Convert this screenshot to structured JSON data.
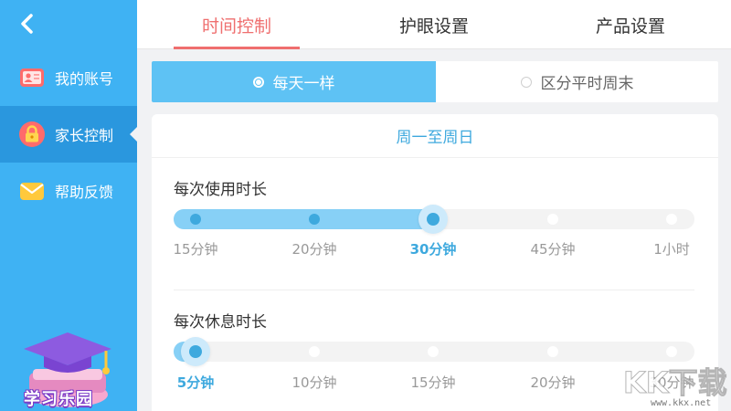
{
  "sidebar": {
    "items": [
      {
        "label": "我的账号",
        "icon": "id-card-icon"
      },
      {
        "label": "家长控制",
        "icon": "lock-icon",
        "active": true
      },
      {
        "label": "帮助反馈",
        "icon": "envelope-icon"
      }
    ],
    "mascot_text": "学习乐园"
  },
  "tabs": [
    {
      "label": "时间控制",
      "active": true
    },
    {
      "label": "护眼设置"
    },
    {
      "label": "产品设置"
    }
  ],
  "mode": {
    "options": [
      "每天一样",
      "区分平时周末"
    ],
    "selected": "每天一样"
  },
  "card": {
    "title": "周一至周日",
    "usage": {
      "label": "每次使用时长",
      "ticks": [
        "15分钟",
        "20分钟",
        "30分钟",
        "45分钟",
        "1小时"
      ],
      "selected": "30分钟"
    },
    "rest": {
      "label": "每次休息时长",
      "ticks": [
        "5分钟",
        "10分钟",
        "15分钟",
        "20分钟",
        "30分钟"
      ],
      "selected": "5分钟"
    }
  },
  "watermark": {
    "logo_text": "KK下载",
    "url": "www.kkx.net"
  },
  "colors": {
    "sidebar": "#3fb2f3",
    "accent": "#3ea9de",
    "tab_active": "#ef6f6f"
  }
}
